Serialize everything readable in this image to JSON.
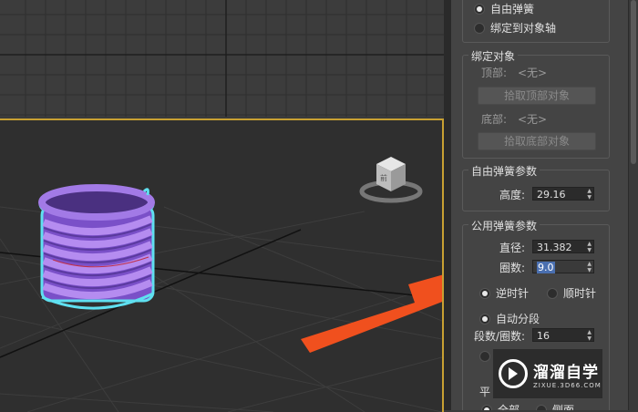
{
  "panel": {
    "spring_mode": {
      "free_spring": "自由弹簧",
      "bind_axis": "绑定到对象轴"
    },
    "bind_objects": {
      "title": "绑定对象",
      "top_label": "顶部:",
      "top_value": "<无>",
      "pick_top": "拾取顶部对象",
      "bottom_label": "底部:",
      "bottom_value": "<无>",
      "pick_bottom": "拾取底部对象"
    },
    "free_params": {
      "title": "自由弹簧参数",
      "height_label": "高度:",
      "height_value": "29.16"
    },
    "common_params": {
      "title": "公用弹簧参数",
      "diameter_label": "直径:",
      "diameter_value": "31.382",
      "turns_label": "圈数:",
      "turns_value": "9.0",
      "ccw": "逆时针",
      "cw": "顺时针",
      "auto_segments": "自动分段",
      "segments_label": "段数/圈数:",
      "segments_value": "16",
      "smooth_partial": "平",
      "all": "全部",
      "sides": "侧面"
    }
  },
  "watermark": {
    "main": "溜溜自学",
    "sub": "ZIXUE.3D66.COM"
  },
  "colors": {
    "spring": "#8c5fd6",
    "spring_outline": "#5fe0f0",
    "viewport_border": "#c8a032",
    "arrow": "#f0501e"
  }
}
